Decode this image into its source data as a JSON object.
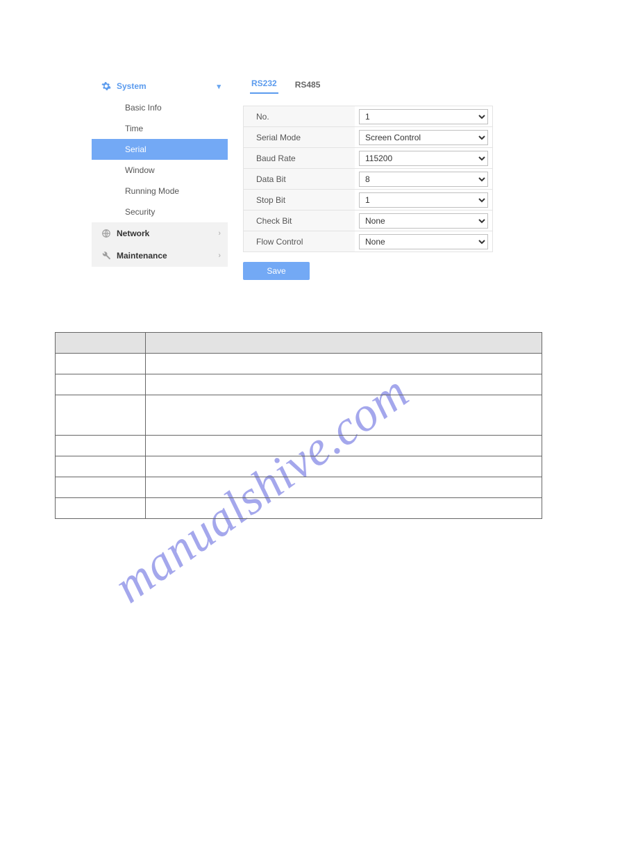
{
  "sidebar": {
    "sections": [
      {
        "label": "System",
        "icon": "gear",
        "expanded": true,
        "active": true
      },
      {
        "label": "Network",
        "icon": "globe",
        "expanded": false,
        "active": false
      },
      {
        "label": "Maintenance",
        "icon": "wrench",
        "expanded": false,
        "active": false
      }
    ],
    "system_items": [
      {
        "label": "Basic Info",
        "selected": false
      },
      {
        "label": "Time",
        "selected": false
      },
      {
        "label": "Serial",
        "selected": true
      },
      {
        "label": "Window",
        "selected": false
      },
      {
        "label": "Running Mode",
        "selected": false
      },
      {
        "label": "Security",
        "selected": false
      }
    ]
  },
  "tabs": [
    {
      "label": "RS232",
      "active": true
    },
    {
      "label": "RS485",
      "active": false
    }
  ],
  "form": {
    "rows": [
      {
        "label": "No.",
        "value": "1"
      },
      {
        "label": "Serial Mode",
        "value": "Screen Control"
      },
      {
        "label": "Baud Rate",
        "value": "115200"
      },
      {
        "label": "Data Bit",
        "value": "8"
      },
      {
        "label": "Stop Bit",
        "value": "1"
      },
      {
        "label": "Check Bit",
        "value": "None"
      },
      {
        "label": "Flow Control",
        "value": "None"
      }
    ],
    "save_label": "Save"
  },
  "watermark": "manualshive.com"
}
